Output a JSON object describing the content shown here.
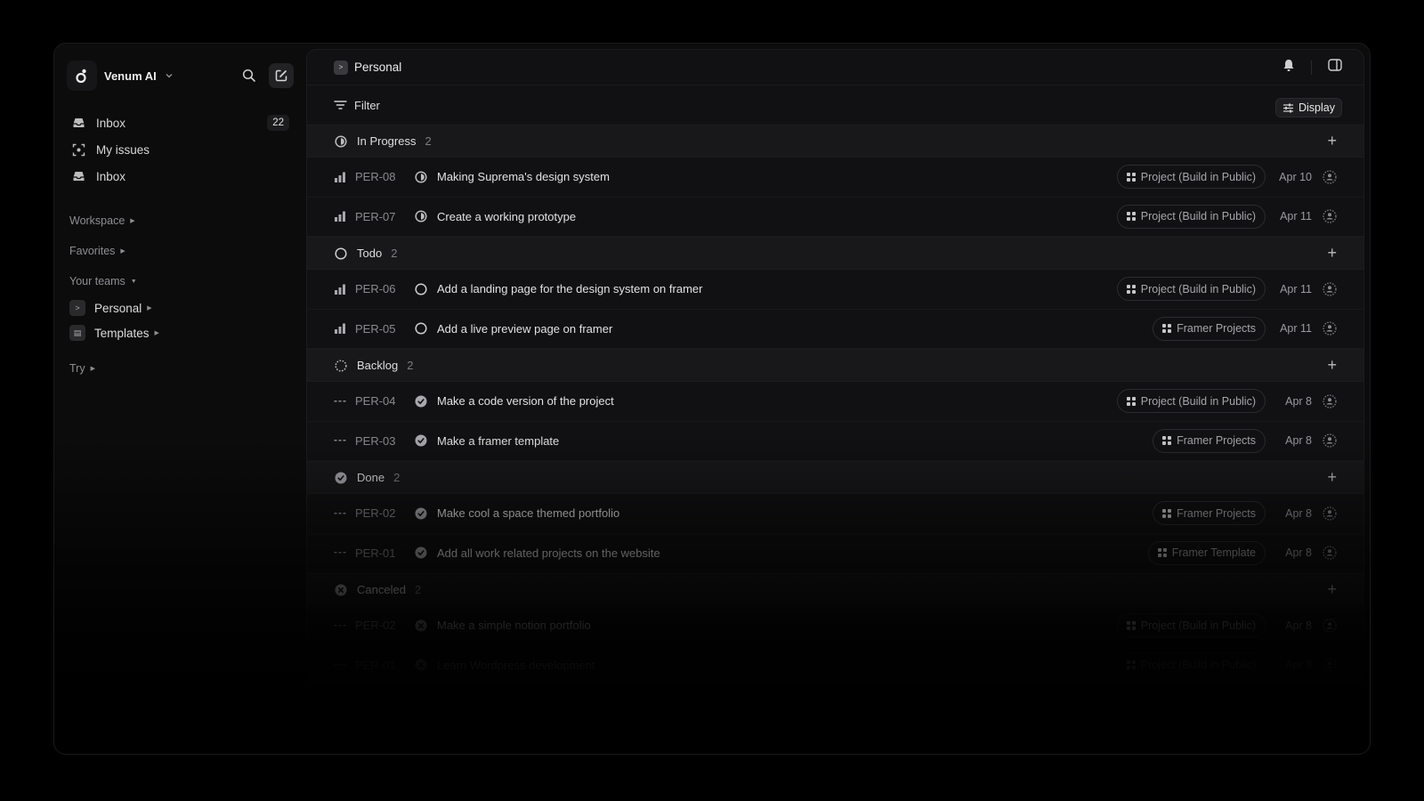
{
  "sidebar": {
    "workspace_name": "Venum AI",
    "nav": [
      {
        "label": "Inbox",
        "icon": "inbox-icon",
        "badge": "22"
      },
      {
        "label": "My issues",
        "icon": "my-issues-icon",
        "badge": null
      },
      {
        "label": "Inbox",
        "icon": "inbox-icon",
        "badge": null
      }
    ],
    "workspace_label": "Workspace",
    "favorites_label": "Favorites",
    "teams_label": "Your teams",
    "teams": [
      {
        "label": "Personal",
        "icon": "terminal-icon"
      },
      {
        "label": "Templates",
        "icon": "template-icon"
      }
    ],
    "try_label": "Try"
  },
  "main": {
    "title": "Personal",
    "filter_label": "Filter",
    "display_label": "Display",
    "groups": [
      {
        "label": "In Progress",
        "count": "2",
        "status": "in-progress",
        "issues": [
          {
            "id": "PER-08",
            "title": "Making Suprema's design system",
            "project": "Project (Build in Public)",
            "date": "Apr 10",
            "priority": "bars"
          },
          {
            "id": "PER-07",
            "title": "Create a working prototype",
            "project": "Project (Build in Public)",
            "date": "Apr 11",
            "priority": "bars"
          }
        ]
      },
      {
        "label": "Todo",
        "count": "2",
        "status": "todo",
        "issues": [
          {
            "id": "PER-06",
            "title": "Add a landing page for the design system on framer",
            "project": "Project (Build in Public)",
            "date": "Apr 11",
            "priority": "bars"
          },
          {
            "id": "PER-05",
            "title": "Add a live preview page on framer",
            "project": "Framer Projects",
            "date": "Apr 11",
            "priority": "bars"
          }
        ]
      },
      {
        "label": "Backlog",
        "count": "2",
        "status": "backlog",
        "issues": [
          {
            "id": "PER-04",
            "title": "Make a code version of the project",
            "project": "Project (Build in Public)",
            "date": "Apr 8",
            "priority": "none"
          },
          {
            "id": "PER-03",
            "title": "Make a framer template",
            "project": "Framer Projects",
            "date": "Apr 8",
            "priority": "none"
          }
        ]
      },
      {
        "label": "Done",
        "count": "2",
        "status": "done",
        "issues": [
          {
            "id": "PER-02",
            "title": "Make cool a space themed portfolio",
            "project": "Framer Projects",
            "date": "Apr 8",
            "priority": "none"
          },
          {
            "id": "PER-01",
            "title": "Add all work related projects on the website",
            "project": "Framer Template",
            "date": "Apr 8",
            "priority": "none"
          }
        ]
      },
      {
        "label": "Canceled",
        "count": "2",
        "status": "canceled",
        "issues": [
          {
            "id": "PER-02",
            "title": "Make a simple notion portfolio",
            "project": "Project (Build in Public)",
            "date": "Apr 8",
            "priority": "none"
          },
          {
            "id": "PER-01",
            "title": "Learn Wordpress development",
            "project": "Project (Build in Public)",
            "date": "Apr 8",
            "priority": "none"
          }
        ]
      }
    ]
  }
}
